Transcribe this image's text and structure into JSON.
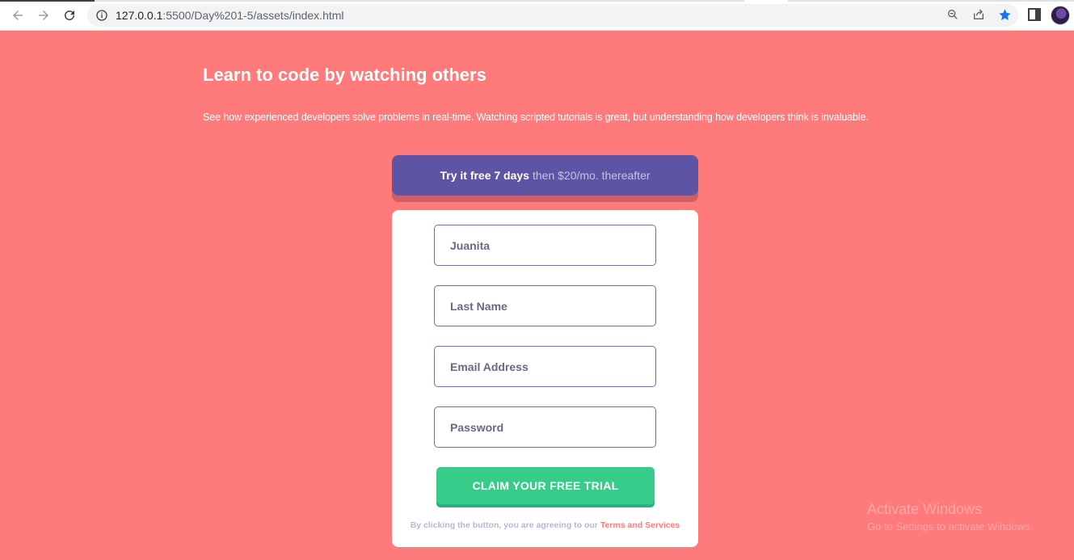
{
  "browser": {
    "url_host": "127.0.0.1",
    "url_path": ":5500/Day%201-5/assets/index.html",
    "icons": [
      "back-icon",
      "forward-icon",
      "reload-icon",
      "info-icon",
      "zoom-icon",
      "share-icon",
      "bookmark-star-icon",
      "side-panel-icon",
      "profile-avatar"
    ]
  },
  "hero": {
    "title": "Learn to code by watching others",
    "text": "See how experienced developers solve problems in real-time. Watching scripted tutorials is great, but understanding how developers think is invaluable."
  },
  "promo": {
    "bold": "Try it free 7 days",
    "light": "then $20/mo. thereafter"
  },
  "form": {
    "first_name_value": "Juanita",
    "last_name_placeholder": "Last Name",
    "email_placeholder": "Email Address",
    "password_placeholder": "Password",
    "cta_label": "CLAIM YOUR FREE TRIAL",
    "terms_prefix": "By clicking the button, you are agreeing to our",
    "terms_link": "Terms and Services"
  },
  "watermark": {
    "line1": "Activate Windows",
    "line2": "Go to Settings to activate Windows."
  },
  "colors": {
    "background": "#ff7a7a",
    "promo": "#5e54a4",
    "cta": "#38cc8b",
    "field_border": "#6e6e9f"
  }
}
